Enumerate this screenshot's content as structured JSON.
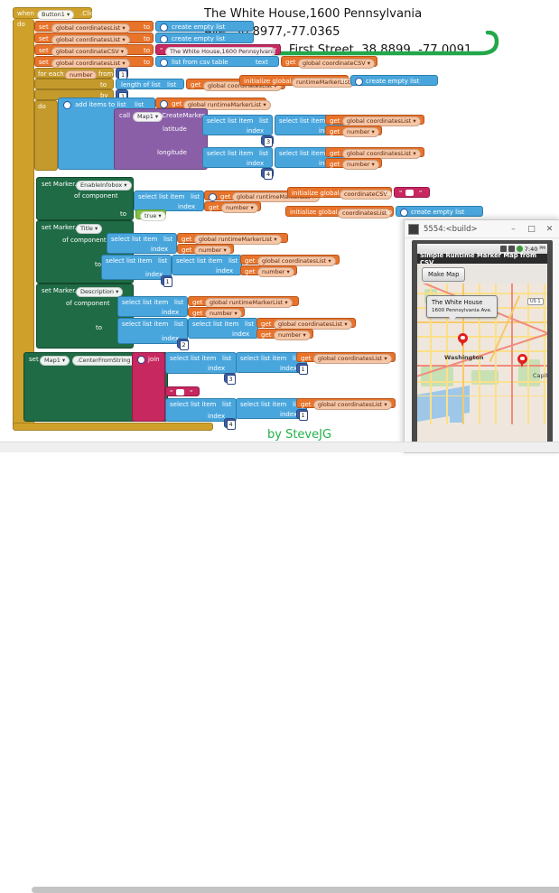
{
  "header": {
    "line1": "The White House,1600 Pennsylvania Ave.,38.8977,-77.0365",
    "line2": "\\nU S Capitol, First Street, 38.8899, -77.0091"
  },
  "credit": "by SteveJG",
  "blocks": {
    "when": "when",
    "button1": "Button1",
    "click": ".Click",
    "do": "do",
    "set": "set",
    "to": "to",
    "global_coordinatesList": "global coordinatesList",
    "global_coordinateCSV": "global coordinateCSV",
    "global_runtimeMarkerList": "global runtimeMarkerList",
    "create_empty_list": "create empty list",
    "csv_text_value": "The White House,1600 Pennsylvania Ave.,38.8977,-...",
    "list_from_csv_table": "list from csv table",
    "text": "text",
    "get": "get",
    "for_each": "for each",
    "number": "number",
    "from": "from",
    "by": "by",
    "length_of_list": "length of list",
    "list": "list",
    "add_items_to_list": "add items to list",
    "item": "item",
    "call": "call",
    "map1": "Map1",
    "create_marker": ".CreateMarker",
    "latitude": "latitude",
    "longitude": "longitude",
    "select_list_item": "select list item",
    "index": "index",
    "initialize_global": "initialize global",
    "runtimeMarkerList": "runtimeMarkerList",
    "coordinateCSV": "coordinateCSV",
    "coordinatesList": "coordinatesList",
    "set_marker": "set Marker.",
    "enable_infobox": "EnableInfobox",
    "title": "Title",
    "description": "Description",
    "of_component": "of component",
    "true": "true",
    "center_from_string": ".CenterFromString",
    "join": "join",
    "num_1": "1",
    "num_2": "2",
    "num_3": "3",
    "num_4": "4"
  },
  "emulator": {
    "window_title": "5554:<build>",
    "minimize": "–",
    "maximize": "□",
    "close": "✕",
    "clock": "7:40",
    "clock_ampm": "PM",
    "app_title": "Simple Runtime Marker Map from CSV",
    "make_map_button": "Make Map",
    "infobox_line1": "The White House",
    "infobox_line2": "1600 Pennsylvania Ave.",
    "map_label_washington": "Washington",
    "map_label_capitol": "Capitol",
    "map_shield": "US 1"
  },
  "colors": {
    "control": "#cfa12b",
    "variables": "#e8732a",
    "lists": "#49a6dd",
    "text_block": "#c7285f",
    "math": "#3c5fa8",
    "logic": "#7fc241",
    "component": "#1f6b45",
    "procedure": "#8a5fa8",
    "credit_green": "#24b04b",
    "arrow_green": "#22a84a"
  }
}
